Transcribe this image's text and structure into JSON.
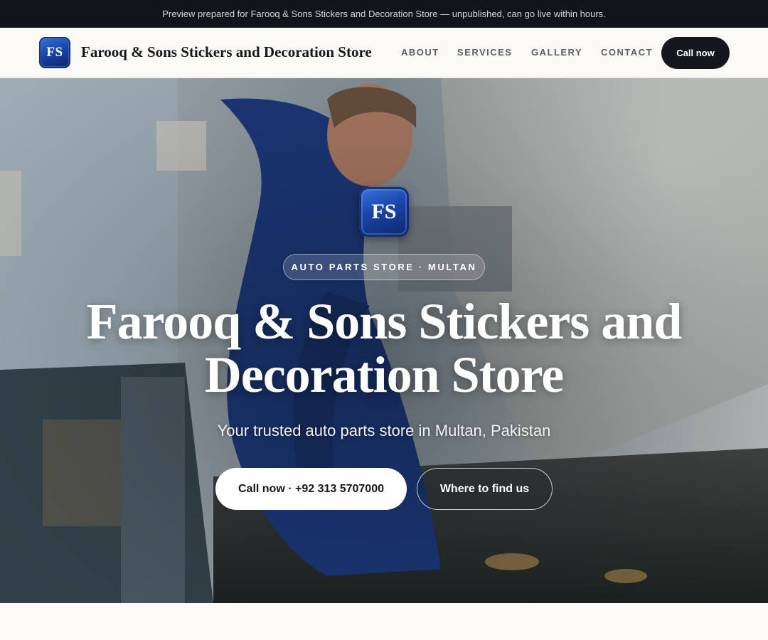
{
  "preview_bar": {
    "text": "Preview prepared for Farooq & Sons Stickers and Decoration Store — unpublished, can go live within hours."
  },
  "nav": {
    "logo_text": "FS",
    "brand": "Farooq & Sons Stickers and Decoration Store",
    "links": [
      "ABOUT",
      "SERVICES",
      "GALLERY",
      "CONTACT"
    ],
    "cta": "Call now"
  },
  "hero": {
    "logo_text": "FS",
    "badge": "AUTO PARTS STORE · MULTAN",
    "title": "Farooq & Sons Stickers and Decoration Store",
    "subtitle": "Your trusted auto parts store in Multan, Pakistan",
    "primary_button": "Call now · +92 313 5707000",
    "secondary_button": "Where to find us"
  },
  "colors": {
    "dark": "#15171c",
    "logo_blue": "#1a45a8",
    "background": "#faf9f6"
  }
}
